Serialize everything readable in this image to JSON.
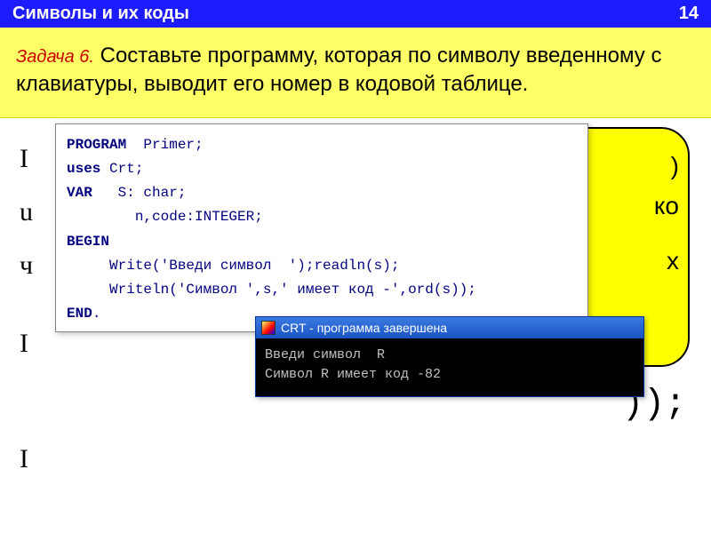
{
  "header": {
    "title": "Символы  и их коды",
    "page_number": "14"
  },
  "task": {
    "label": "Задача 6.",
    "text": "Составьте программу, которая по символу введенному с клавиатуры, выводит его номер в кодовой таблице."
  },
  "bubble_fragments": [
    ")",
    "ко",
    "х"
  ],
  "paren_fragment": "));",
  "left_letters": [
    "I",
    "u",
    "ч",
    "I",
    "I"
  ],
  "code_lines": {
    "l1_kw": "PROGRAM",
    "l1_rest": "  Primer;",
    "l2_kw": "uses",
    "l2_rest": " Crt;",
    "l3_kw": "VAR",
    "l3_rest": "   S: char;",
    "l4": "        n,code:INTEGER;",
    "l5_kw": "BEGIN",
    "l6": "     Write('Введи символ  ');readln(s);",
    "l7": "     Writeln('Символ ',s,' имеет код -',ord(s));",
    "l8_kw": "END",
    "l8_rest": "."
  },
  "crt": {
    "title": "CRT - программа завершена",
    "output_line1": "Введи символ  R",
    "output_line2": "Символ R имеет код -82"
  }
}
